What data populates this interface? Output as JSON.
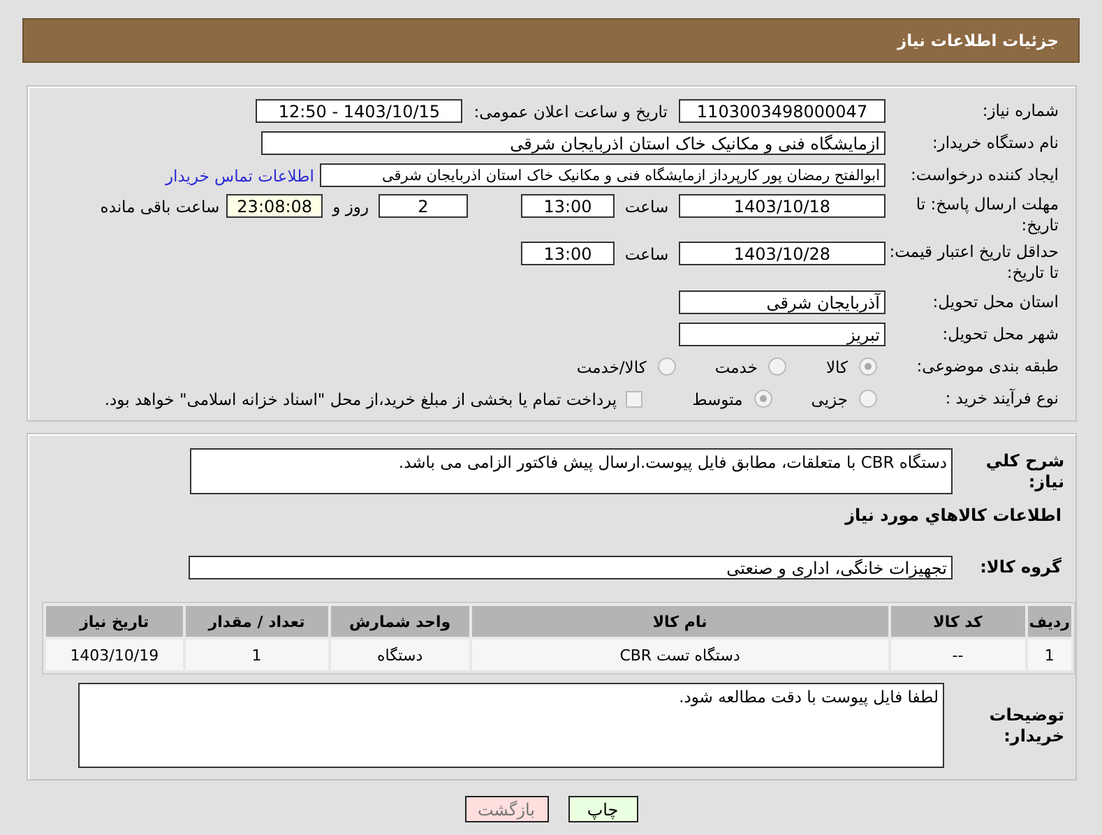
{
  "header": {
    "title": "جزئیات اطلاعات نیاز"
  },
  "need_number": {
    "label": "شماره نیاز:",
    "value": "1103003498000047"
  },
  "announce_datetime": {
    "label": "تاریخ و ساعت اعلان عمومی:",
    "value": "1403/10/15 - 12:50"
  },
  "buyer_org": {
    "label": "نام دستگاه خریدار:",
    "value": "ازمایشگاه فنی و مکانیک خاک استان اذربایجان شرقی"
  },
  "requester": {
    "label": "ایجاد کننده درخواست:",
    "value": "ابوالفتح رمضان پور کارپرداز ازمایشگاه فنی و مکانیک خاک استان اذربایجان شرقی",
    "link": "اطلاعات تماس خریدار"
  },
  "reply_deadline": {
    "label": "مهلت ارسال پاسخ: تا تاریخ:",
    "date": "1403/10/18",
    "time_label": "ساعت",
    "time": "13:00",
    "days": "2",
    "days_label": "روز و",
    "remaining": "23:08:08",
    "remaining_label": "ساعت باقی مانده"
  },
  "price_validity": {
    "label": "حداقل تاریخ اعتبار قیمت: تا تاریخ:",
    "date": "1403/10/28",
    "time_label": "ساعت",
    "time": "13:00"
  },
  "delivery_province": {
    "label": "استان محل تحویل:",
    "value": "آذربایجان شرقی"
  },
  "delivery_city": {
    "label": "شهر محل تحویل:",
    "value": "تبریز"
  },
  "category": {
    "label": "طبقه بندی موضوعی:",
    "options": [
      {
        "label": "کالا",
        "selected": true
      },
      {
        "label": "خدمت",
        "selected": false
      },
      {
        "label": "کالا/خدمت",
        "selected": false
      }
    ]
  },
  "purchase_process": {
    "label": "نوع فرآیند خرید :",
    "options": [
      {
        "label": "جزیی",
        "selected": false
      },
      {
        "label": "متوسط",
        "selected": true
      }
    ],
    "treasury": {
      "label": "پرداخت تمام یا بخشی از مبلغ خرید،از محل \"اسناد خزانه اسلامی\" خواهد بود.",
      "checked": false
    }
  },
  "description": {
    "label": "شرح كلي نياز:",
    "value": "دستگاه CBR با متعلقات، مطابق فایل پیوست.ارسال پیش فاکتور الزامی می باشد."
  },
  "goods_heading": "اطلاعات كالاهاي مورد نياز",
  "goods_group": {
    "label": "گروه کالا:",
    "value": "تجهیزات خانگی، اداری و صنعتی"
  },
  "table": {
    "columns": [
      "ردیف",
      "کد کالا",
      "نام کالا",
      "واحد شمارش",
      "تعداد / مقدار",
      "تاریخ نیاز"
    ],
    "rows": [
      [
        "1",
        "--",
        "دستگاه تست CBR",
        "دستگاه",
        "1",
        "1403/10/19"
      ]
    ]
  },
  "buyer_notes": {
    "label": "توضیحات خریدار:",
    "value": "لطفا فایل پیوست با دقت مطالعه شود."
  },
  "buttons": [
    {
      "label": "چاپ",
      "kind": "print"
    },
    {
      "label": "بازگشت",
      "kind": "back"
    }
  ]
}
